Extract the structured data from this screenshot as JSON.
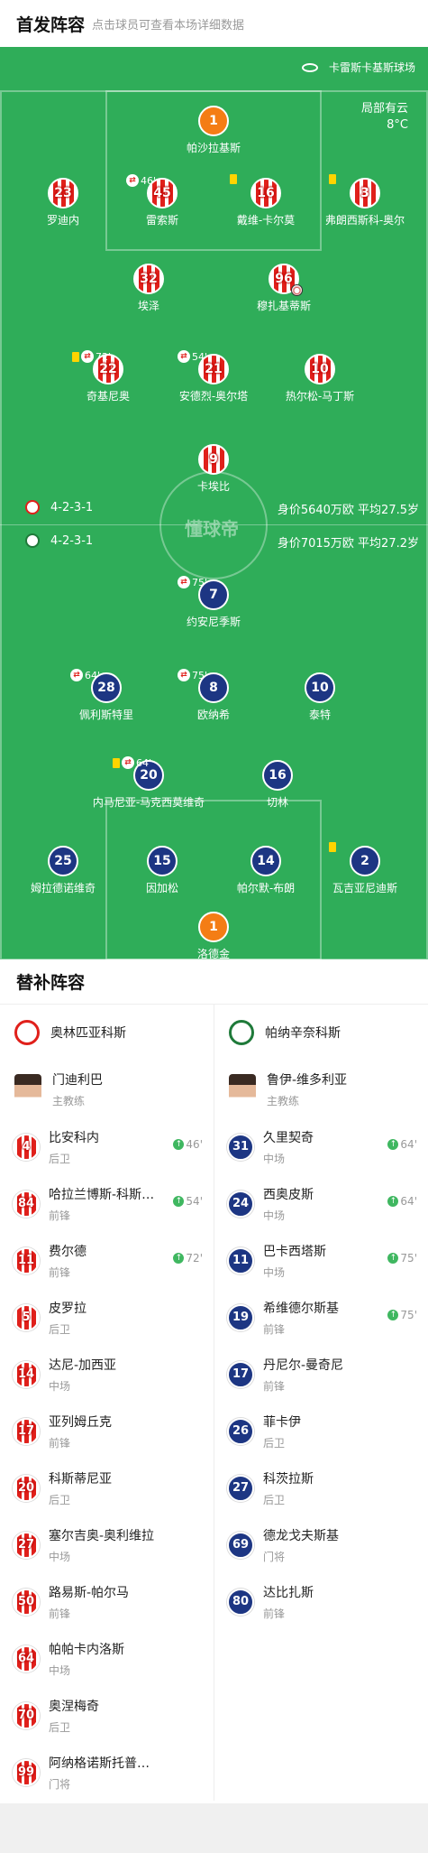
{
  "header": {
    "title": "首发阵容",
    "subtitle": "点击球员可查看本场详细数据"
  },
  "pitch": {
    "stadium": "卡雷斯卡基斯球场",
    "weather": "局部有云",
    "temp": "8°C",
    "watermark": "懂球帝",
    "home": {
      "formation": "4-2-3-1",
      "value": "身价5640万欧 平均27.5岁"
    },
    "away": {
      "formation": "4-2-3-1",
      "value": "身价7015万欧 平均27.2岁"
    },
    "home_players": [
      {
        "num": "1",
        "name": "帕沙拉基斯",
        "gk": true
      },
      {
        "num": "23",
        "name": "罗迪内"
      },
      {
        "num": "45",
        "name": "雷索斯",
        "sub": "46'"
      },
      {
        "num": "16",
        "name": "戴维-卡尔莫",
        "yc": true
      },
      {
        "num": "3",
        "name": "弗朗西斯科-奥尔",
        "yc": true
      },
      {
        "num": "32",
        "name": "埃泽"
      },
      {
        "num": "96",
        "name": "穆扎基蒂斯",
        "goal": true
      },
      {
        "num": "22",
        "name": "奇基尼奥",
        "yc": true,
        "sub": "72'"
      },
      {
        "num": "21",
        "name": "安德烈-奥尔塔",
        "sub": "54'"
      },
      {
        "num": "10",
        "name": "热尔松-马丁斯"
      },
      {
        "num": "9",
        "name": "卡埃比"
      }
    ],
    "away_players": [
      {
        "num": "7",
        "name": "约安尼季斯",
        "sub": "75'"
      },
      {
        "num": "28",
        "name": "佩利斯特里",
        "sub": "64'"
      },
      {
        "num": "8",
        "name": "欧纳希",
        "sub": "75'"
      },
      {
        "num": "10",
        "name": "泰特"
      },
      {
        "num": "20",
        "name": "内马尼亚-马克西莫维奇",
        "yc": true,
        "sub": "64'"
      },
      {
        "num": "16",
        "name": "切林"
      },
      {
        "num": "25",
        "name": "姆拉德诺维奇"
      },
      {
        "num": "15",
        "name": "因加松"
      },
      {
        "num": "14",
        "name": "帕尔默-布朗"
      },
      {
        "num": "2",
        "name": "瓦吉亚尼迪斯",
        "yc": true
      },
      {
        "num": "1",
        "name": "洛德金",
        "gk": true
      }
    ]
  },
  "subs": {
    "title": "替补阵容",
    "home_team": "奥林匹亚科斯",
    "away_team": "帕纳辛奈科斯",
    "home_coach": {
      "name": "门迪利巴",
      "role": "主教练"
    },
    "away_coach": {
      "name": "鲁伊-维多利亚",
      "role": "主教练"
    },
    "home": [
      {
        "num": "4",
        "name": "比安科内",
        "pos": "后卫",
        "in": "46'"
      },
      {
        "num": "84",
        "name": "哈拉兰博斯-科斯图拉斯",
        "pos": "前锋",
        "in": "54'"
      },
      {
        "num": "11",
        "name": "费尔德",
        "pos": "前锋",
        "in": "72'"
      },
      {
        "num": "5",
        "name": "皮罗拉",
        "pos": "后卫"
      },
      {
        "num": "14",
        "name": "达尼-加西亚",
        "pos": "中场"
      },
      {
        "num": "17",
        "name": "亚列姆丘克",
        "pos": "前锋"
      },
      {
        "num": "20",
        "name": "科斯蒂尼亚",
        "pos": "后卫"
      },
      {
        "num": "27",
        "name": "塞尔吉奥-奥利维拉",
        "pos": "中场"
      },
      {
        "num": "50",
        "name": "路易斯-帕尔马",
        "pos": "前锋"
      },
      {
        "num": "64",
        "name": "帕帕卡内洛斯",
        "pos": "中场"
      },
      {
        "num": "70",
        "name": "奥涅梅奇",
        "pos": "后卫"
      },
      {
        "num": "99",
        "name": "阿纳格诺斯托普洛斯",
        "pos": "门将"
      }
    ],
    "away": [
      {
        "num": "31",
        "name": "久里契奇",
        "pos": "中场",
        "in": "64'"
      },
      {
        "num": "24",
        "name": "西奥皮斯",
        "pos": "中场",
        "in": "64'"
      },
      {
        "num": "11",
        "name": "巴卡西塔斯",
        "pos": "中场",
        "in": "75'"
      },
      {
        "num": "19",
        "name": "希维德尔斯基",
        "pos": "前锋",
        "in": "75'"
      },
      {
        "num": "17",
        "name": "丹尼尔-曼奇尼",
        "pos": "前锋"
      },
      {
        "num": "26",
        "name": "菲卡伊",
        "pos": "后卫"
      },
      {
        "num": "27",
        "name": "科茨拉斯",
        "pos": "后卫"
      },
      {
        "num": "69",
        "name": "德龙戈夫斯基",
        "pos": "门将"
      },
      {
        "num": "80",
        "name": "达比扎斯",
        "pos": "前锋"
      }
    ]
  }
}
